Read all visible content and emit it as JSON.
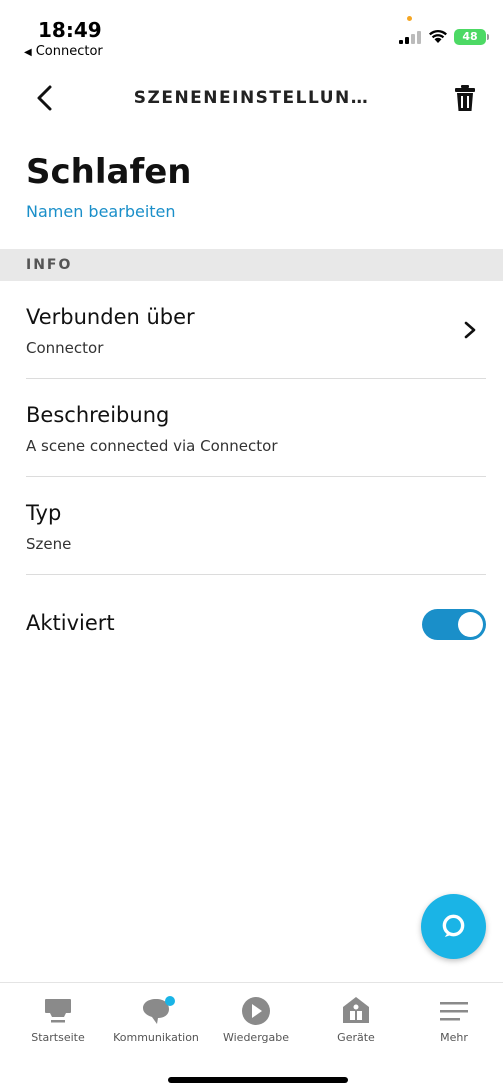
{
  "status_bar": {
    "time": "18:49",
    "back_app": "Connector",
    "battery": "48"
  },
  "nav": {
    "title": "SZENENEINSTELLUN…",
    "back_icon": "chevron-left-icon",
    "delete_icon": "trash-icon"
  },
  "scene": {
    "name": "Schlafen",
    "rename_label": "Namen bearbeiten"
  },
  "section": {
    "header": "INFO"
  },
  "rows": {
    "connected": {
      "title": "Verbunden über",
      "value": "Connector"
    },
    "description": {
      "title": "Beschreibung",
      "value": "A scene connected via Connector"
    },
    "type": {
      "title": "Typ",
      "value": "Szene"
    },
    "enabled": {
      "title": "Aktiviert",
      "state": "on"
    }
  },
  "alexa_button": {
    "icon": "alexa-ring-icon"
  },
  "tabs": [
    {
      "label": "Startseite",
      "icon": "home-icon"
    },
    {
      "label": "Kommunikation",
      "icon": "chat-bubble-icon"
    },
    {
      "label": "Wiedergabe",
      "icon": "play-icon"
    },
    {
      "label": "Geräte",
      "icon": "devices-icon"
    },
    {
      "label": "Mehr",
      "icon": "menu-icon"
    }
  ],
  "colors": {
    "accent": "#1a8fc9",
    "alexa": "#1ab4e6",
    "notification_dot": "#1ab4e6",
    "battery": "#4cd964"
  }
}
